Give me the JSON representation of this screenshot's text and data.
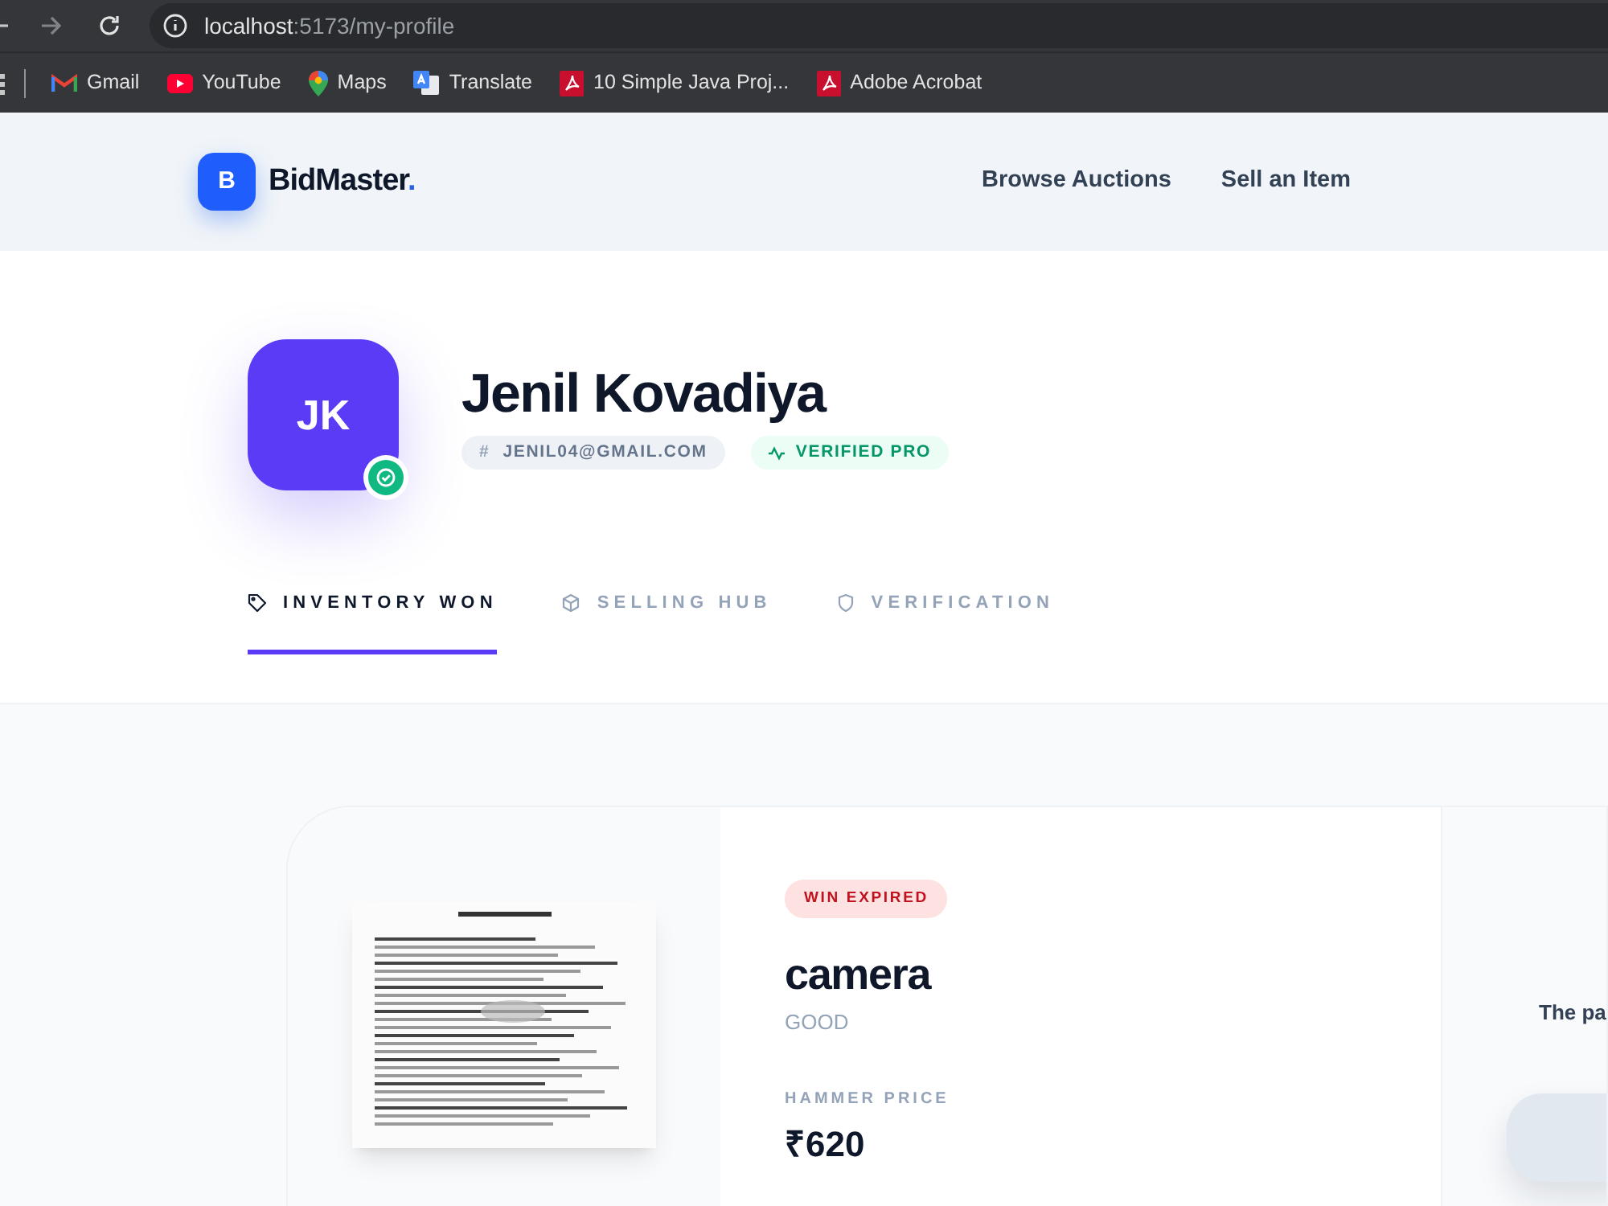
{
  "browser": {
    "url_host": "localhost",
    "url_path": ":5173/my-profile",
    "bookmarks": [
      {
        "kind": "gmail",
        "label": "Gmail"
      },
      {
        "kind": "youtube",
        "label": "YouTube"
      },
      {
        "kind": "maps",
        "label": "Maps"
      },
      {
        "kind": "translate",
        "label": "Translate"
      },
      {
        "kind": "pdf",
        "label": "10 Simple Java Proj..."
      },
      {
        "kind": "pdf",
        "label": "Adobe Acrobat"
      }
    ]
  },
  "header": {
    "logo_letter": "B",
    "brand": "BidMaster",
    "brand_dot": ".",
    "nav": [
      "Browse Auctions",
      "Sell an Item"
    ]
  },
  "profile": {
    "initials": "JK",
    "verified": true,
    "name": "Jenil Kovadiya",
    "email_prefix": "#",
    "email": "JENIL04@GMAIL.COM",
    "badge": "VERIFIED PRO"
  },
  "tabs": [
    {
      "kind": "tag",
      "label": "INVENTORY WON",
      "selected": true
    },
    {
      "kind": "box",
      "label": "SELLING HUB",
      "selected": false
    },
    {
      "kind": "shield",
      "label": "VERIFICATION",
      "selected": false
    }
  ],
  "card": {
    "status": "WIN EXPIRED",
    "title": "camera",
    "condition": "GOOD",
    "price_label": "HAMMER PRICE",
    "price": "₹620",
    "side_text": "The pa"
  }
}
